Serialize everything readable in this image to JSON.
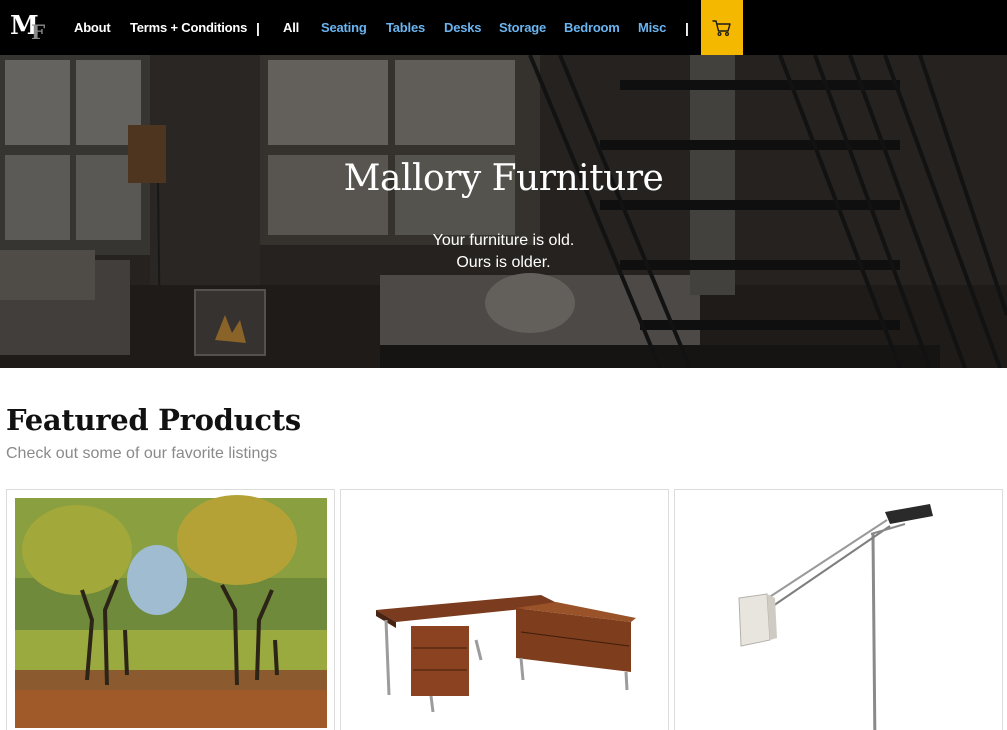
{
  "brand": {
    "logo_m": "M",
    "logo_f": "F"
  },
  "nav": {
    "links": [
      {
        "label": "About"
      },
      {
        "label": "Terms + Conditions"
      }
    ],
    "separator": "|",
    "categories": [
      {
        "label": "All"
      },
      {
        "label": "Seating"
      },
      {
        "label": "Tables"
      },
      {
        "label": "Desks"
      },
      {
        "label": "Storage"
      },
      {
        "label": "Bedroom"
      },
      {
        "label": "Misc"
      }
    ],
    "cart_icon": "cart-icon"
  },
  "hero": {
    "title": "Mallory Furniture",
    "line1": "Your furniture is old.",
    "line2": "Ours is older."
  },
  "featured": {
    "title": "Featured Products",
    "subtitle": "Check out some of our favorite listings"
  },
  "colors": {
    "nav_bg": "#000000",
    "cart_accent": "#f5b800",
    "category_link": "#6ab4f0",
    "muted_text": "#8a8a8a"
  }
}
